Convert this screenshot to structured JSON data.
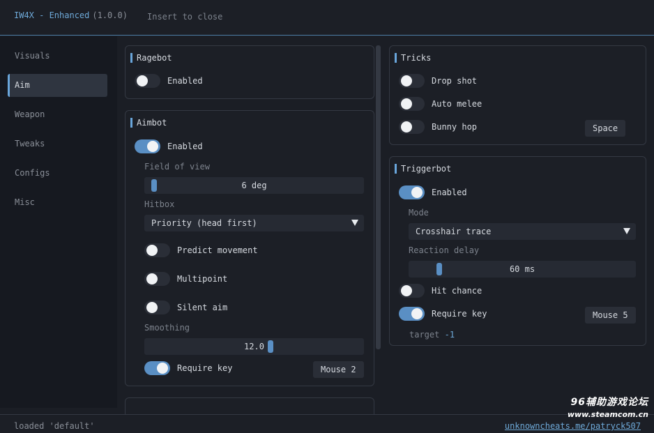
{
  "header": {
    "title": "IW4X - Enhanced",
    "version": "(1.0.0)",
    "hint": "Insert to close"
  },
  "sidebar": {
    "items": [
      {
        "label": "Visuals",
        "active": false
      },
      {
        "label": "Aim",
        "active": true
      },
      {
        "label": "Weapon",
        "active": false
      },
      {
        "label": "Tweaks",
        "active": false
      },
      {
        "label": "Configs",
        "active": false
      },
      {
        "label": "Misc",
        "active": false
      }
    ]
  },
  "ragebot": {
    "title": "Ragebot",
    "enabled": {
      "label": "Enabled",
      "on": false
    }
  },
  "aimbot": {
    "title": "Aimbot",
    "enabled": {
      "label": "Enabled",
      "on": true
    },
    "fov": {
      "label": "Field of view",
      "value": "6 deg"
    },
    "hitbox": {
      "label": "Hitbox",
      "value": "Priority (head first)"
    },
    "predict": {
      "label": "Predict movement",
      "on": false
    },
    "multipoint": {
      "label": "Multipoint",
      "on": false
    },
    "silent": {
      "label": "Silent aim",
      "on": false
    },
    "smoothing": {
      "label": "Smoothing",
      "value": "12.0"
    },
    "require_key": {
      "label": "Require key",
      "on": true,
      "key": "Mouse 2"
    }
  },
  "tricks": {
    "title": "Tricks",
    "drop_shot": {
      "label": "Drop shot",
      "on": false
    },
    "auto_melee": {
      "label": "Auto melee",
      "on": false
    },
    "bunny_hop": {
      "label": "Bunny hop",
      "on": false,
      "key": "Space"
    }
  },
  "triggerbot": {
    "title": "Triggerbot",
    "enabled": {
      "label": "Enabled",
      "on": true
    },
    "mode": {
      "label": "Mode",
      "value": "Crosshair trace"
    },
    "delay": {
      "label": "Reaction delay",
      "value": "60 ms"
    },
    "hit_chance": {
      "label": "Hit chance",
      "on": false
    },
    "require_key": {
      "label": "Require key",
      "on": true,
      "key": "Mouse 5"
    },
    "target": {
      "label": "target",
      "value": "-1"
    }
  },
  "footer": {
    "status": "loaded 'default'",
    "link": "unknowncheats.me/patryck507"
  },
  "watermark": {
    "line1": "96辅助游戏论坛",
    "line2": "www.steamcom.cn"
  },
  "colors": {
    "accent": "#6aa6db",
    "toggle_on": "#5a8fc4",
    "background": "#1b1e25",
    "panel": "#1c1f26"
  }
}
